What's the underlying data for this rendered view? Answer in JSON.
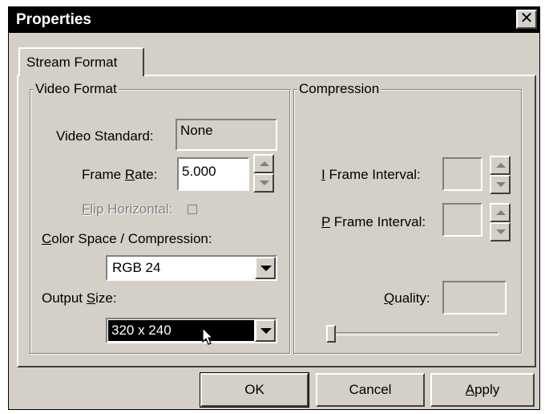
{
  "window": {
    "title": "Properties",
    "close_glyph": "✕"
  },
  "tabs": [
    {
      "label": "Stream Format"
    }
  ],
  "video_format": {
    "group_label": "Video Format",
    "video_standard": {
      "label": "Video Standard:",
      "value": "None"
    },
    "frame_rate": {
      "label_pre": "Frame ",
      "label_ul": "R",
      "label_post": "ate:",
      "value": "5.000"
    },
    "flip_horizontal": {
      "label_ul": "F",
      "label_post": "lip Horizontal:",
      "checked": false,
      "disabled": true
    },
    "color_space": {
      "label_ul": "C",
      "label_post": "olor Space / Compression:",
      "value": "RGB 24"
    },
    "output_size": {
      "label_pre": "Output ",
      "label_ul": "S",
      "label_post": "ize:",
      "value": "320 x 240"
    }
  },
  "compression": {
    "group_label": "Compression",
    "i_frame": {
      "label_ul": "I",
      "label_post": " Frame Interval:",
      "value": ""
    },
    "p_frame": {
      "label_ul": "P",
      "label_post": " Frame Interval:",
      "value": ""
    },
    "quality": {
      "label_ul": "Q",
      "label_post": "uality:",
      "value": "",
      "slider_fraction": 0.0
    }
  },
  "buttons": {
    "ok": "OK",
    "cancel": "Cancel",
    "apply_ul": "A",
    "apply_post": "pply"
  },
  "icons": [
    "close-icon",
    "spin-up-icon",
    "spin-down-icon",
    "dropdown-arrow-icon",
    "mouse-cursor-icon"
  ]
}
